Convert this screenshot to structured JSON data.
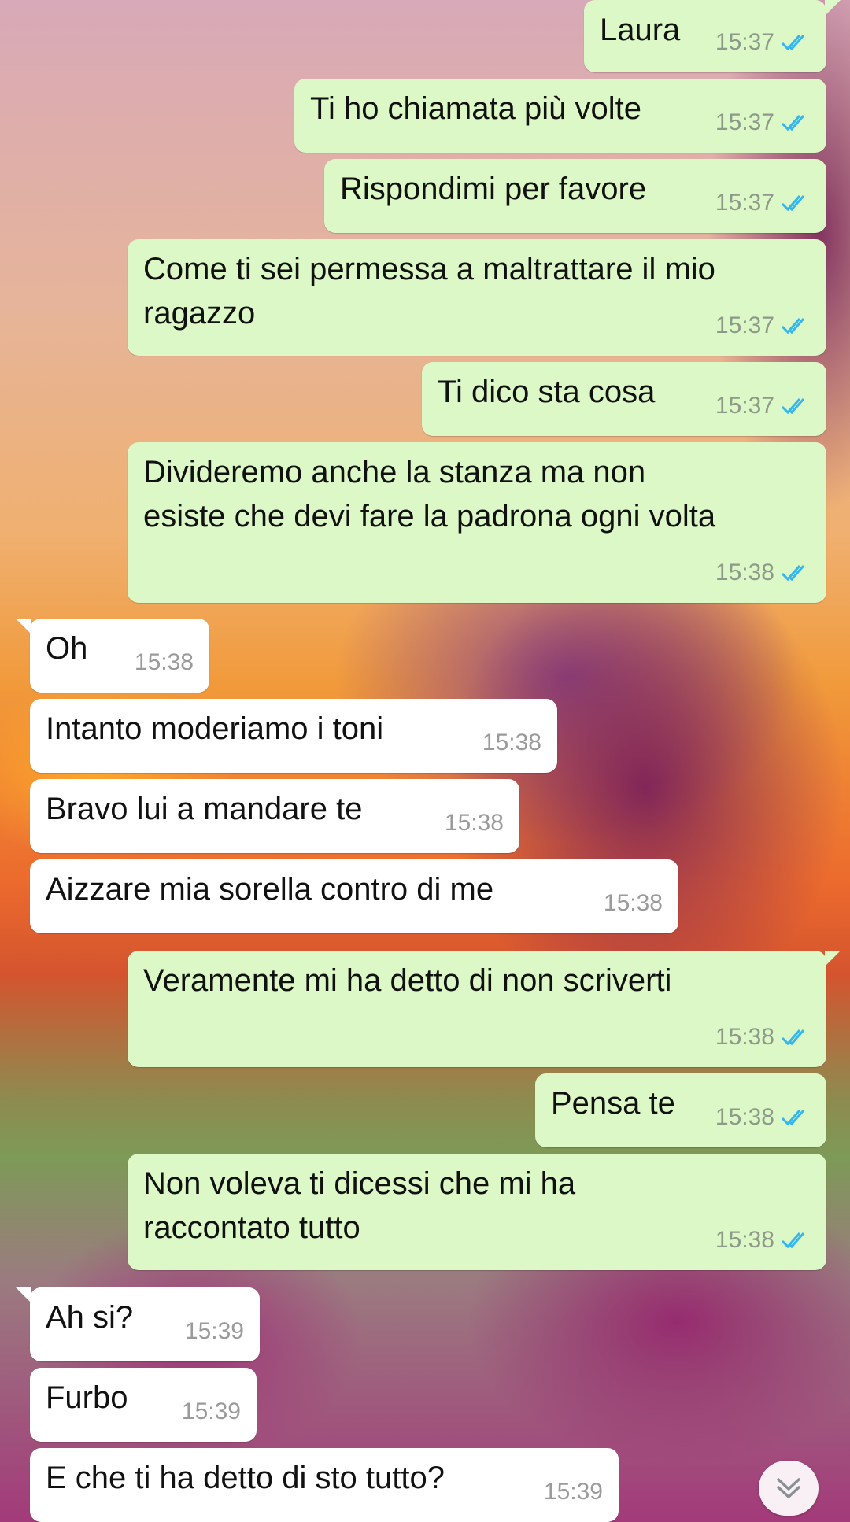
{
  "chat": {
    "messages": [
      {
        "dir": "out",
        "text": "Laura",
        "time": "15:37",
        "status_icon": "double-check-read-icon"
      },
      {
        "dir": "out",
        "text": "Ti ho chiamata più volte",
        "time": "15:37",
        "status_icon": "double-check-read-icon"
      },
      {
        "dir": "out",
        "text": "Rispondimi per favore",
        "time": "15:37",
        "status_icon": "double-check-read-icon"
      },
      {
        "dir": "out",
        "text": "Come ti sei permessa a maltrattare il mio\nragazzo",
        "time": "15:37",
        "status_icon": "double-check-read-icon"
      },
      {
        "dir": "out",
        "text": "Ti dico sta cosa",
        "time": "15:37",
        "status_icon": "double-check-read-icon"
      },
      {
        "dir": "out",
        "text": "Divideremo anche la stanza ma non\nesiste che devi fare la padrona ogni volta",
        "time": "15:38",
        "status_icon": "double-check-read-icon"
      },
      {
        "dir": "in",
        "text": "Oh",
        "time": "15:38"
      },
      {
        "dir": "in",
        "text": "Intanto moderiamo i toni",
        "time": "15:38"
      },
      {
        "dir": "in",
        "text": "Bravo lui a mandare te",
        "time": "15:38"
      },
      {
        "dir": "in",
        "text": "Aizzare mia sorella contro di me",
        "time": "15:38"
      },
      {
        "dir": "out",
        "text": "Veramente mi ha detto di non scriverti",
        "time": "15:38",
        "status_icon": "double-check-read-icon"
      },
      {
        "dir": "out",
        "text": "Pensa te",
        "time": "15:38",
        "status_icon": "double-check-read-icon"
      },
      {
        "dir": "out",
        "text": "Non voleva ti dicessi che mi ha\nraccontato tutto",
        "time": "15:38",
        "status_icon": "double-check-read-icon"
      },
      {
        "dir": "in",
        "text": "Ah si?",
        "time": "15:39"
      },
      {
        "dir": "in",
        "text": "Furbo",
        "time": "15:39"
      },
      {
        "dir": "in",
        "text": "E che ti ha detto di sto tutto?",
        "time": "15:39"
      }
    ],
    "scroll_button_icon": "chevron-double-down-icon",
    "colors": {
      "outgoing_bubble": "#dcf8c6",
      "incoming_bubble": "#ffffff",
      "read_ticks": "#34b7f1",
      "timestamp": "#8d9a8a"
    }
  }
}
